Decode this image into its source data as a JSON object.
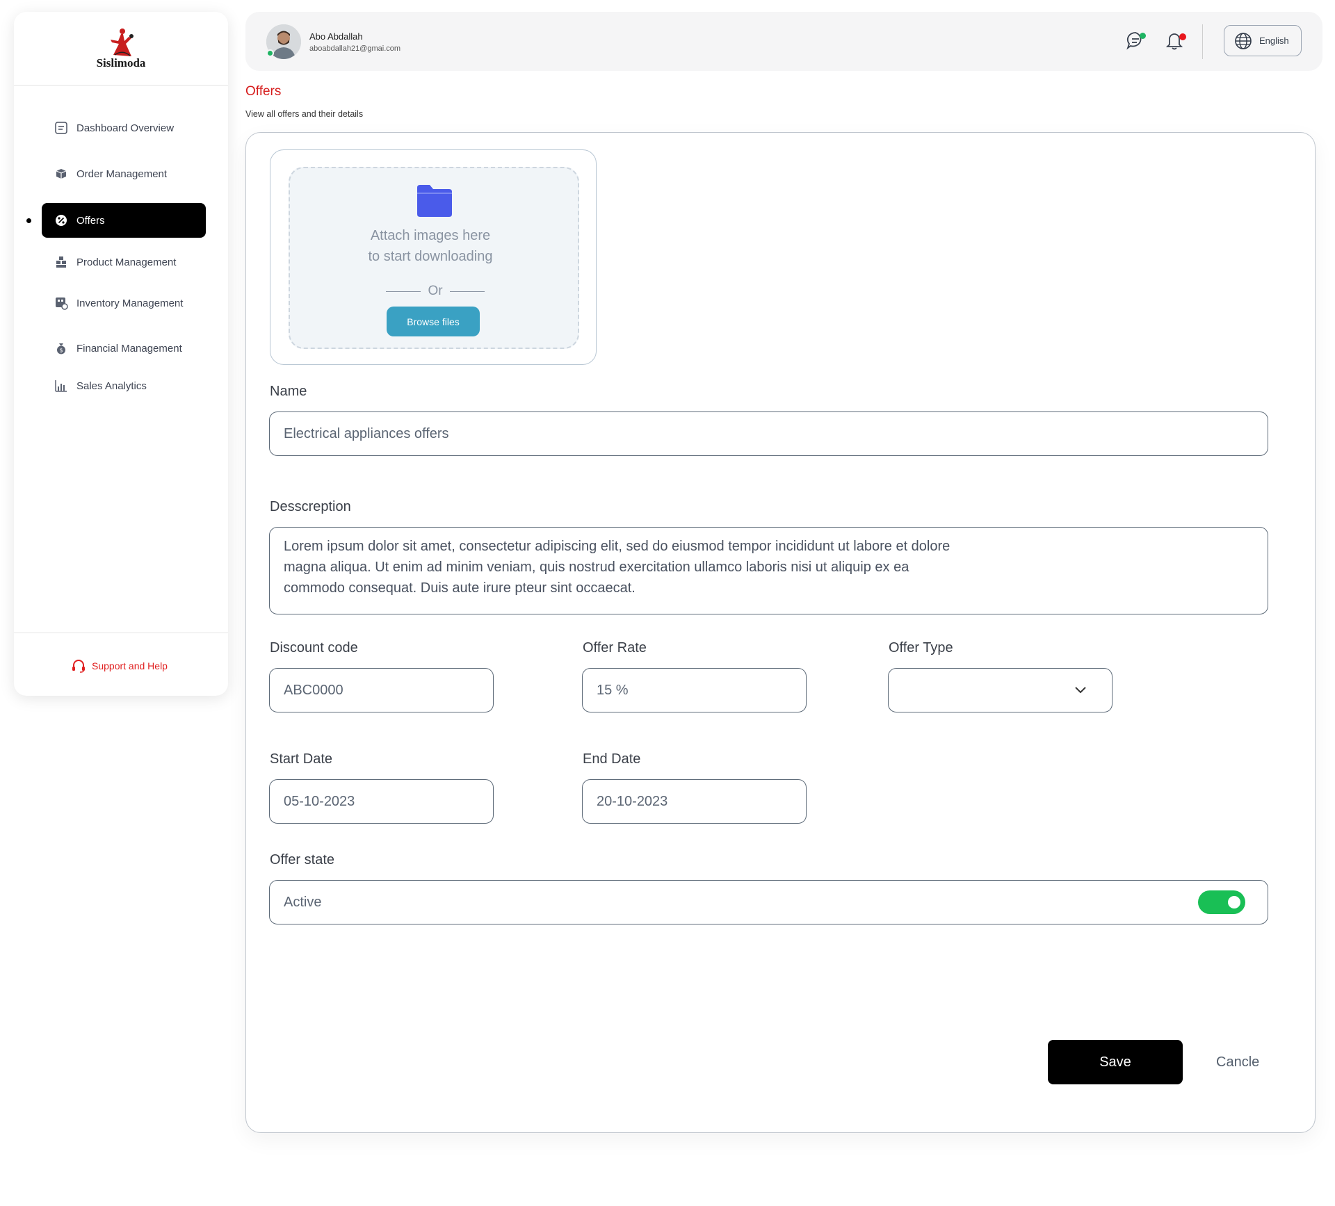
{
  "brand": {
    "name": "Sislimoda",
    "accent": "#d61c1c"
  },
  "sidebar": {
    "items": [
      {
        "label": "Dashboard Overview",
        "icon": "dashboard-icon",
        "active": false
      },
      {
        "label": "Order Management",
        "icon": "boxes-icon",
        "active": false
      },
      {
        "label": "Offers",
        "icon": "discount-icon",
        "active": true
      },
      {
        "label": "Product Management",
        "icon": "product-stack-icon",
        "active": false
      },
      {
        "label": "Inventory Management",
        "icon": "inventory-icon",
        "active": false
      },
      {
        "label": "Financial Management",
        "icon": "money-bag-icon",
        "active": false
      },
      {
        "label": "Sales Analytics",
        "icon": "bar-chart-icon",
        "active": false
      }
    ],
    "support_label": "Support and Help"
  },
  "header": {
    "user_name": "Abo Abdallah",
    "user_email": "aboabdallah21@gmai.com",
    "language": "English"
  },
  "page": {
    "title": "Offers",
    "subtitle": "View all offers and their details"
  },
  "upload": {
    "line1": "Attach images here",
    "line2": "to start downloading",
    "or_label": "Or",
    "browse_label": "Browse files"
  },
  "form": {
    "name_label": "Name",
    "name_value": "Electrical appliances offers",
    "description_label": "Desscreption",
    "description_lines": [
      "Lorem ipsum dolor sit amet, consectetur adipiscing elit, sed do eiusmod tempor incididunt ut labore et dolore",
      "magna aliqua. Ut enim ad minim veniam, quis nostrud exercitation ullamco laboris nisi ut aliquip ex ea",
      "commodo consequat. Duis aute irure pteur sint occaecat."
    ],
    "discount_code_label": "Discount code",
    "discount_code_value": "ABC0000",
    "offer_rate_label": "Offer Rate",
    "offer_rate_value": "15 %",
    "offer_type_label": "Offer Type",
    "offer_type_value": "",
    "start_date_label": "Start Date",
    "start_date_value": "05-10-2023",
    "end_date_label": "End Date",
    "end_date_value": "20-10-2023",
    "offer_state_label": "Offer state",
    "offer_state_value": "Active",
    "offer_state_on": true
  },
  "actions": {
    "save_label": "Save",
    "cancel_label": "Cancle"
  },
  "colors": {
    "toggle_on": "#19bf55",
    "browse_button": "#3aa1c3",
    "online": "#1fb463",
    "notification": "#e8161c"
  }
}
